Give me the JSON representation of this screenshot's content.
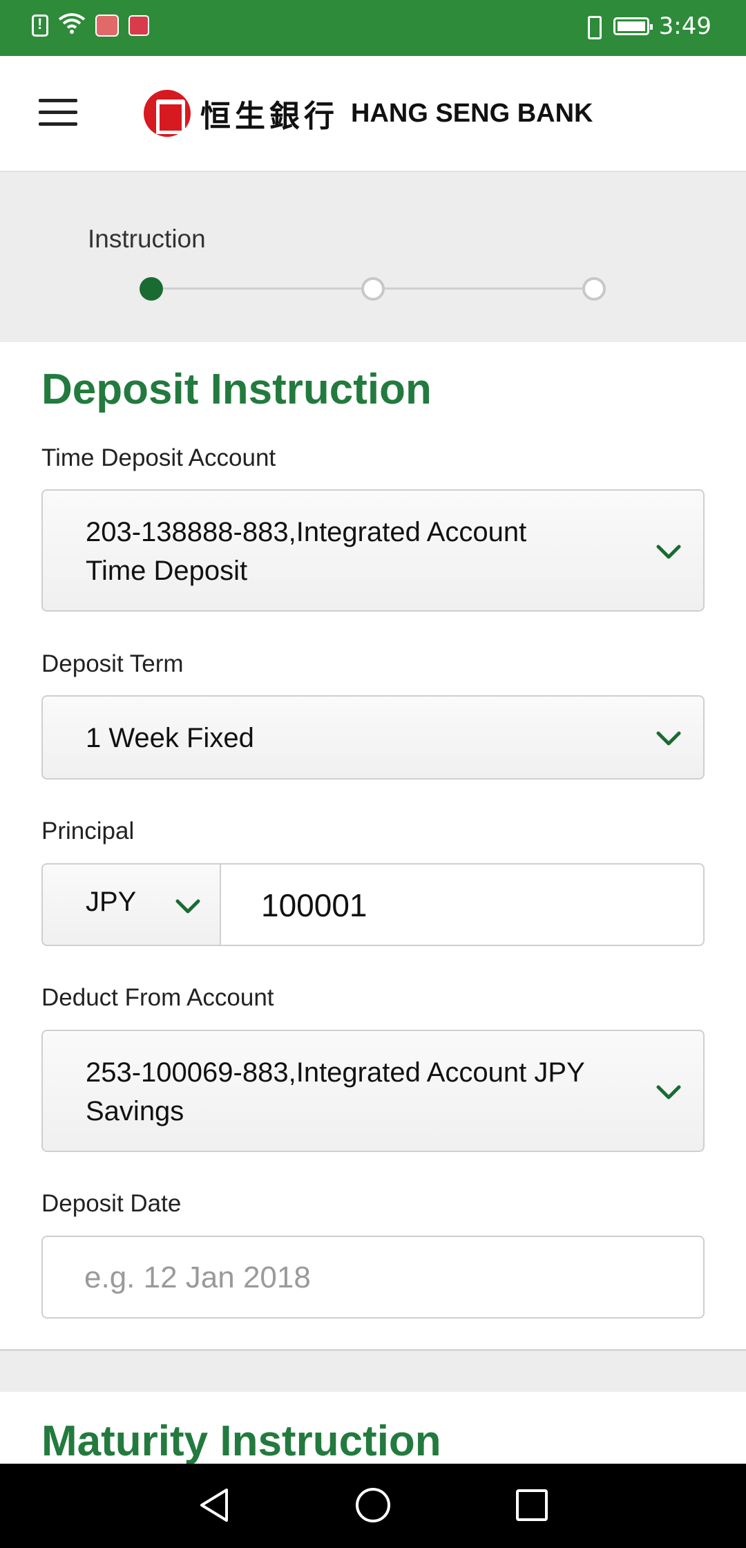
{
  "status_bar": {
    "time": "3:49",
    "icons": [
      "alert-icon",
      "wifi-icon",
      "huawei-app-icon",
      "book-app-icon",
      "vibrate-icon",
      "battery-icon"
    ]
  },
  "header": {
    "logo_chinese": "恒生銀行",
    "logo_english": "HANG SENG BANK",
    "brand_color": "#d71920"
  },
  "stepper": {
    "current_label": "Instruction",
    "steps": 3,
    "current_step": 1,
    "active_color": "#1a6b32"
  },
  "deposit_instruction": {
    "title": "Deposit Instruction",
    "time_deposit_account": {
      "label": "Time Deposit Account",
      "value_line1": "203-138888-883,Integrated Account",
      "value_line2": "Time Deposit"
    },
    "deposit_term": {
      "label": "Deposit Term",
      "value": "1 Week Fixed"
    },
    "principal": {
      "label": "Principal",
      "currency": "JPY",
      "amount": "100001"
    },
    "deduct_from_account": {
      "label": "Deduct From Account",
      "value_line1": "253-100069-883,Integrated Account JPY",
      "value_line2": "Savings"
    },
    "deposit_date": {
      "label": "Deposit Date",
      "placeholder": "e.g. 12 Jan 2018"
    }
  },
  "maturity_instruction": {
    "title": "Maturity Instruction"
  },
  "accent_color": "#237a3e"
}
